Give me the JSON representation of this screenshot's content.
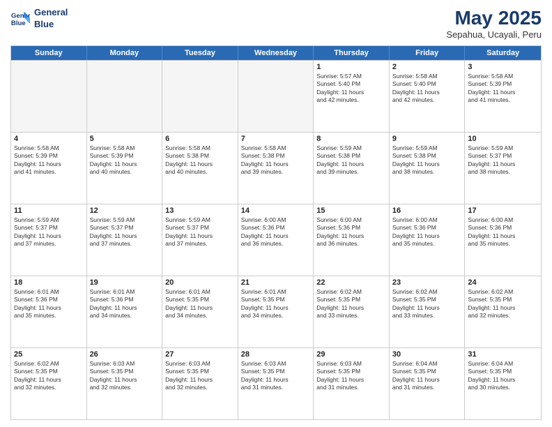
{
  "header": {
    "logo_line1": "General",
    "logo_line2": "Blue",
    "month": "May 2025",
    "location": "Sepahua, Ucayali, Peru"
  },
  "weekdays": [
    "Sunday",
    "Monday",
    "Tuesday",
    "Wednesday",
    "Thursday",
    "Friday",
    "Saturday"
  ],
  "rows": [
    [
      {
        "day": "",
        "info": ""
      },
      {
        "day": "",
        "info": ""
      },
      {
        "day": "",
        "info": ""
      },
      {
        "day": "",
        "info": ""
      },
      {
        "day": "1",
        "info": "Sunrise: 5:57 AM\nSunset: 5:40 PM\nDaylight: 11 hours\nand 42 minutes."
      },
      {
        "day": "2",
        "info": "Sunrise: 5:58 AM\nSunset: 5:40 PM\nDaylight: 11 hours\nand 42 minutes."
      },
      {
        "day": "3",
        "info": "Sunrise: 5:58 AM\nSunset: 5:39 PM\nDaylight: 11 hours\nand 41 minutes."
      }
    ],
    [
      {
        "day": "4",
        "info": "Sunrise: 5:58 AM\nSunset: 5:39 PM\nDaylight: 11 hours\nand 41 minutes."
      },
      {
        "day": "5",
        "info": "Sunrise: 5:58 AM\nSunset: 5:39 PM\nDaylight: 11 hours\nand 40 minutes."
      },
      {
        "day": "6",
        "info": "Sunrise: 5:58 AM\nSunset: 5:38 PM\nDaylight: 11 hours\nand 40 minutes."
      },
      {
        "day": "7",
        "info": "Sunrise: 5:58 AM\nSunset: 5:38 PM\nDaylight: 11 hours\nand 39 minutes."
      },
      {
        "day": "8",
        "info": "Sunrise: 5:59 AM\nSunset: 5:38 PM\nDaylight: 11 hours\nand 39 minutes."
      },
      {
        "day": "9",
        "info": "Sunrise: 5:59 AM\nSunset: 5:38 PM\nDaylight: 11 hours\nand 38 minutes."
      },
      {
        "day": "10",
        "info": "Sunrise: 5:59 AM\nSunset: 5:37 PM\nDaylight: 11 hours\nand 38 minutes."
      }
    ],
    [
      {
        "day": "11",
        "info": "Sunrise: 5:59 AM\nSunset: 5:37 PM\nDaylight: 11 hours\nand 37 minutes."
      },
      {
        "day": "12",
        "info": "Sunrise: 5:59 AM\nSunset: 5:37 PM\nDaylight: 11 hours\nand 37 minutes."
      },
      {
        "day": "13",
        "info": "Sunrise: 5:59 AM\nSunset: 5:37 PM\nDaylight: 11 hours\nand 37 minutes."
      },
      {
        "day": "14",
        "info": "Sunrise: 6:00 AM\nSunset: 5:36 PM\nDaylight: 11 hours\nand 36 minutes."
      },
      {
        "day": "15",
        "info": "Sunrise: 6:00 AM\nSunset: 5:36 PM\nDaylight: 11 hours\nand 36 minutes."
      },
      {
        "day": "16",
        "info": "Sunrise: 6:00 AM\nSunset: 5:36 PM\nDaylight: 11 hours\nand 35 minutes."
      },
      {
        "day": "17",
        "info": "Sunrise: 6:00 AM\nSunset: 5:36 PM\nDaylight: 11 hours\nand 35 minutes."
      }
    ],
    [
      {
        "day": "18",
        "info": "Sunrise: 6:01 AM\nSunset: 5:36 PM\nDaylight: 11 hours\nand 35 minutes."
      },
      {
        "day": "19",
        "info": "Sunrise: 6:01 AM\nSunset: 5:36 PM\nDaylight: 11 hours\nand 34 minutes."
      },
      {
        "day": "20",
        "info": "Sunrise: 6:01 AM\nSunset: 5:35 PM\nDaylight: 11 hours\nand 34 minutes."
      },
      {
        "day": "21",
        "info": "Sunrise: 6:01 AM\nSunset: 5:35 PM\nDaylight: 11 hours\nand 34 minutes."
      },
      {
        "day": "22",
        "info": "Sunrise: 6:02 AM\nSunset: 5:35 PM\nDaylight: 11 hours\nand 33 minutes."
      },
      {
        "day": "23",
        "info": "Sunrise: 6:02 AM\nSunset: 5:35 PM\nDaylight: 11 hours\nand 33 minutes."
      },
      {
        "day": "24",
        "info": "Sunrise: 6:02 AM\nSunset: 5:35 PM\nDaylight: 11 hours\nand 32 minutes."
      }
    ],
    [
      {
        "day": "25",
        "info": "Sunrise: 6:02 AM\nSunset: 5:35 PM\nDaylight: 11 hours\nand 32 minutes."
      },
      {
        "day": "26",
        "info": "Sunrise: 6:03 AM\nSunset: 5:35 PM\nDaylight: 11 hours\nand 32 minutes."
      },
      {
        "day": "27",
        "info": "Sunrise: 6:03 AM\nSunset: 5:35 PM\nDaylight: 11 hours\nand 32 minutes."
      },
      {
        "day": "28",
        "info": "Sunrise: 6:03 AM\nSunset: 5:35 PM\nDaylight: 11 hours\nand 31 minutes."
      },
      {
        "day": "29",
        "info": "Sunrise: 6:03 AM\nSunset: 5:35 PM\nDaylight: 11 hours\nand 31 minutes."
      },
      {
        "day": "30",
        "info": "Sunrise: 6:04 AM\nSunset: 5:35 PM\nDaylight: 11 hours\nand 31 minutes."
      },
      {
        "day": "31",
        "info": "Sunrise: 6:04 AM\nSunset: 5:35 PM\nDaylight: 11 hours\nand 30 minutes."
      }
    ]
  ]
}
